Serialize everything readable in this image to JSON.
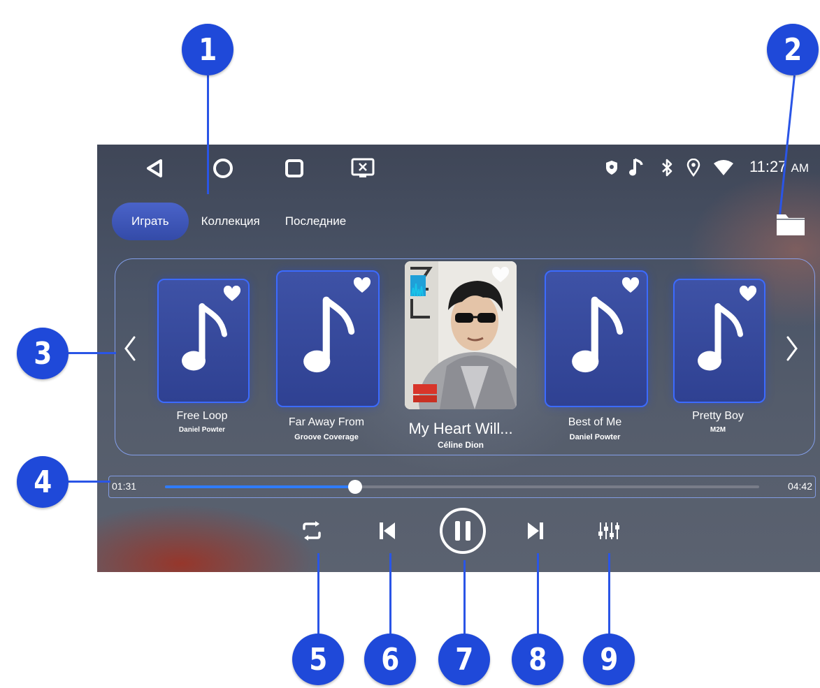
{
  "callouts": [
    "1",
    "2",
    "3",
    "4",
    "5",
    "6",
    "7",
    "8",
    "9"
  ],
  "status_bar": {
    "nav_buttons": [
      "back-icon",
      "home-icon",
      "recents-icon",
      "screen-cast-icon"
    ],
    "status_icons": [
      "shield-icon",
      "music-note-icon",
      "bluetooth-icon",
      "location-icon",
      "wifi-icon"
    ],
    "time": "11:27",
    "ampm": "AM"
  },
  "tabs": [
    {
      "label": "Играть",
      "active": true
    },
    {
      "label": "Коллекция",
      "active": false
    },
    {
      "label": "Последние",
      "active": false
    }
  ],
  "folder_icon": "folder-icon",
  "carousel": {
    "prev_icon": "chevron-left-icon",
    "next_icon": "chevron-right-icon",
    "items": [
      {
        "title": "Free Loop",
        "artist": "Daniel Powter"
      },
      {
        "title": "Far Away From",
        "artist": "Groove Coverage"
      },
      {
        "title": "My Heart Will...",
        "artist": "Céline Dion",
        "current": true
      },
      {
        "title": "Best of Me",
        "artist": "Daniel Powter"
      },
      {
        "title": "Pretty Boy",
        "artist": "M2M"
      }
    ]
  },
  "playback": {
    "elapsed": "01:31",
    "duration": "04:42",
    "progress_fraction": 0.32
  },
  "controls": [
    "repeat-icon",
    "previous-track-icon",
    "pause-icon",
    "next-track-icon",
    "equalizer-icon"
  ],
  "colors": {
    "callout": "#1f49d9",
    "accent": "#2f7cff",
    "tab_active": "#3f57b8",
    "card_border": "#3c6bff"
  }
}
